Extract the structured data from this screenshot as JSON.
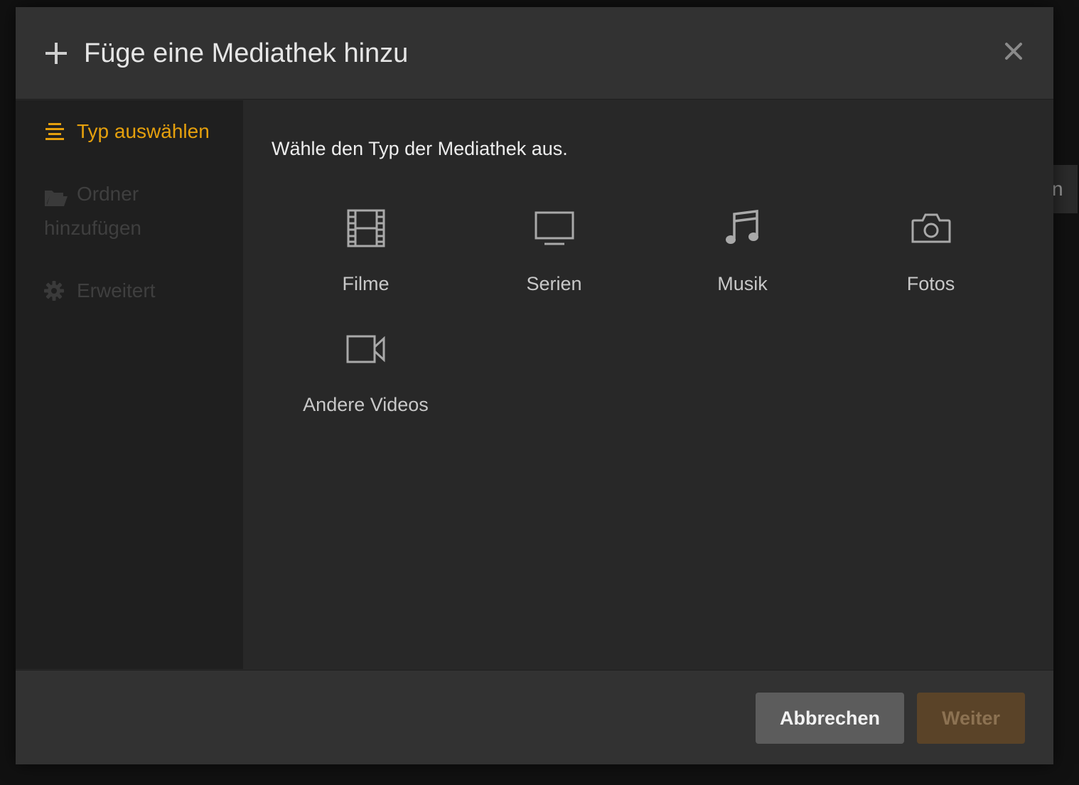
{
  "background": {
    "tab_fragment": "n"
  },
  "modal": {
    "title": "Füge eine Mediathek hinzu",
    "close_icon": "close-icon",
    "header_icon": "plus-icon"
  },
  "sidebar": {
    "steps": [
      {
        "label": "Typ auswählen",
        "icon": "list-icon",
        "state": "active"
      },
      {
        "label": "Ordner hinzufügen",
        "icon": "folder-icon",
        "state": "disabled"
      },
      {
        "label": "Erweitert",
        "icon": "gear-icon",
        "state": "disabled"
      }
    ]
  },
  "content": {
    "instruction": "Wähle den Typ der Mediathek aus.",
    "types": [
      {
        "label": "Filme",
        "icon": "film-icon"
      },
      {
        "label": "Serien",
        "icon": "tv-icon"
      },
      {
        "label": "Musik",
        "icon": "music-icon"
      },
      {
        "label": "Fotos",
        "icon": "camera-icon"
      },
      {
        "label": "Andere Videos",
        "icon": "video-camera-icon"
      }
    ]
  },
  "footer": {
    "cancel_label": "Abbrechen",
    "next_label": "Weiter"
  },
  "colors": {
    "accent": "#e5a00d",
    "disabled_text": "#3f3f3f",
    "next_button_bg": "#5a4328"
  }
}
